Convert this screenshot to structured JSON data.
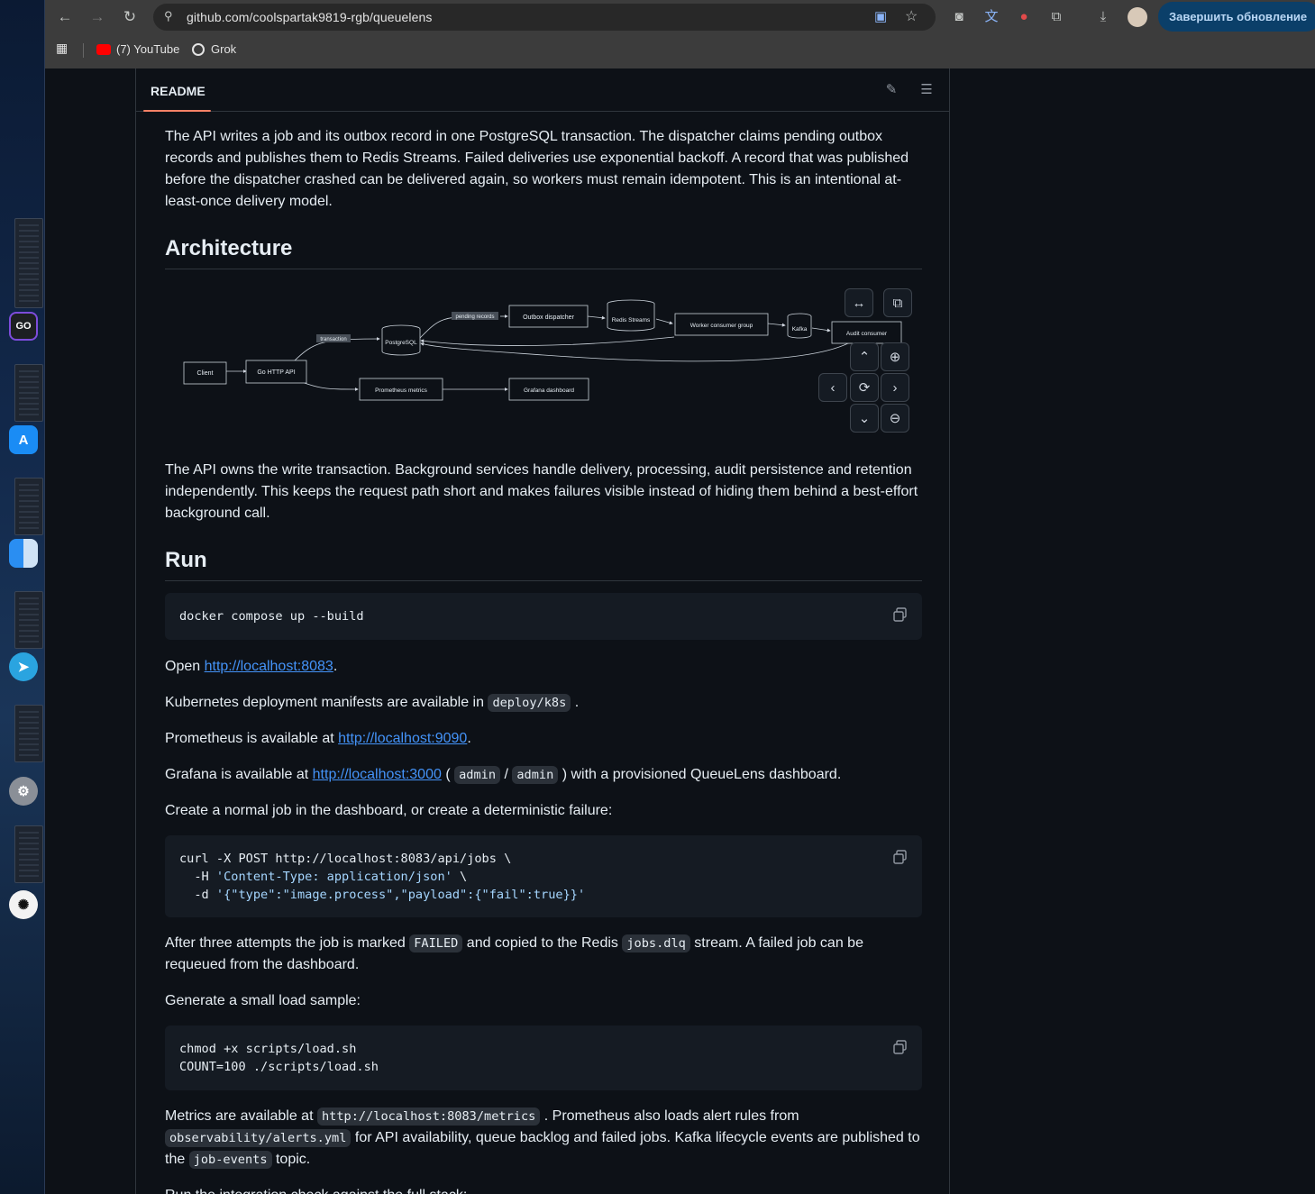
{
  "browser": {
    "url": "github.com/coolspartak9819-rgb/queuelens",
    "update_button": "Завершить обновление",
    "bookmarks": [
      {
        "label": "(7) YouTube"
      },
      {
        "label": "Grok"
      }
    ]
  },
  "readme": {
    "tab_label": "README",
    "intro": "The API writes a job and its outbox record in one PostgreSQL transaction. The dispatcher claims pending outbox records and publishes them to Redis Streams. Failed deliveries use exponential backoff. A record that was published before the dispatcher crashed can be delivered again, so workers must remain idempotent. This is an intentional at-least-once delivery model.",
    "architecture_heading": "Architecture",
    "diagram": {
      "nodes": {
        "client": "Client",
        "api": "Go HTTP API",
        "postgres": "PostgreSQL",
        "dispatcher": "Outbox dispatcher",
        "redis": "Redis Streams",
        "worker": "Worker consumer group",
        "kafka": "Kafka",
        "audit": "Audit consumer",
        "prometheus": "Prometheus metrics",
        "grafana": "Grafana dashboard"
      },
      "edge_labels": {
        "transaction": "transaction",
        "pending": "pending records"
      }
    },
    "architecture_text": "The API owns the write transaction. Background services handle delivery, processing, audit persistence and retention independently. This keeps the request path short and makes failures visible instead of hiding them behind a best-effort background call.",
    "run_heading": "Run",
    "run_code": "docker compose up --build",
    "open": {
      "prefix": "Open ",
      "link": "http://localhost:8083",
      "suffix": "."
    },
    "k8s": {
      "prefix": "Kubernetes deployment manifests are available in ",
      "code": "deploy/k8s",
      "suffix": " ."
    },
    "prometheus": {
      "prefix": "Prometheus is available at ",
      "link": "http://localhost:9090",
      "suffix": "."
    },
    "grafana": {
      "prefix": "Grafana is available at ",
      "link": "http://localhost:3000",
      "open_paren": " ( ",
      "user": "admin",
      "slash": " / ",
      "pass": "admin",
      "suffix": " ) with a provisioned QueueLens dashboard."
    },
    "create_job": "Create a normal job in the dashboard, or create a deterministic failure:",
    "curl": {
      "line1": "curl -X POST http://localhost:8083/api/jobs \\",
      "line2_a": "  -H ",
      "line2_str": "'Content-Type: application/json'",
      "line2_b": " \\",
      "line3_a": "  -d ",
      "line3_str": "'{\"type\":\"image.process\",\"payload\":{\"fail\":true}}'"
    },
    "after": {
      "p1": "After three attempts the job is marked ",
      "code1": "FAILED",
      "p2": " and copied to the Redis ",
      "code2": "jobs.dlq",
      "p3": " stream. A failed job can be requeued from the dashboard."
    },
    "load_intro": "Generate a small load sample:",
    "load_code": {
      "line1": "chmod +x scripts/load.sh",
      "line2": "COUNT=100 ./scripts/load.sh"
    },
    "metrics": {
      "p1": "Metrics are available at ",
      "code1": "http://localhost:8083/metrics",
      "p2": " . Prometheus also loads alert rules from ",
      "code2": "observability/alerts.yml",
      "p3": " for API availability, queue backlog and failed jobs. Kafka lifecycle events are published to the ",
      "code3": "job-events",
      "p4": " topic."
    },
    "cut_off": "Run the integration check against the full stack:"
  },
  "colors": {
    "accent_underline": "#f78166",
    "link": "#4493f8",
    "background": "#0d1117"
  }
}
